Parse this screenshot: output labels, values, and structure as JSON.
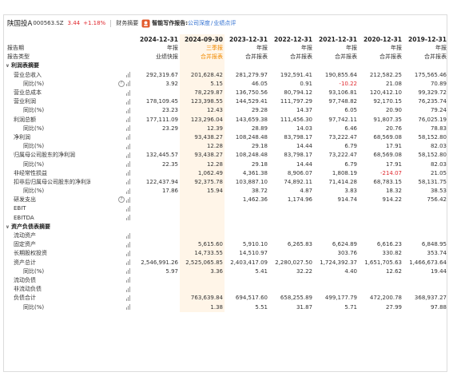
{
  "header": {
    "stock_name": "陕国投A",
    "stock_code": "000563.SZ",
    "price": "3.44",
    "change_pct": "+1.18%",
    "nav_label": "财务摘要",
    "ai_label": "智能写作报告:",
    "ai_link_1": "公司深度",
    "ai_slash": "/",
    "ai_link_2": "业绩点评"
  },
  "columns": {
    "dates": [
      "2024-12-31",
      "2024-09-30",
      "2023-12-31",
      "2022-12-31",
      "2021-12-31",
      "2020-12-31",
      "2019-12-31"
    ],
    "period_label": "报告期",
    "periods": [
      "年报",
      "三季报",
      "年报",
      "年报",
      "年报",
      "年报",
      "年报"
    ],
    "type_label": "报告类型",
    "types": [
      "业绩快报",
      "合并报表",
      "合并报表",
      "合并报表",
      "合并报表",
      "合并报表",
      "合并报表"
    ],
    "highlight_index": 1
  },
  "rows": [
    {
      "label": "利润表摘要",
      "kind": "section",
      "values": [
        "",
        "",
        "",
        "",
        "",
        "",
        ""
      ]
    },
    {
      "label": "营业总收入",
      "kind": "item",
      "icon": "bar",
      "values": [
        "292,319.67",
        "201,628.42",
        "281,279.97",
        "192,591.41",
        "190,855.64",
        "212,582.25",
        "175,565.46"
      ]
    },
    {
      "label": "同比(%)",
      "kind": "sub",
      "icon": "help-bar",
      "values": [
        "3.92",
        "5.15",
        "46.05",
        "0.91",
        "-10.22",
        "21.08",
        "70.89"
      ]
    },
    {
      "label": "营业总成本",
      "kind": "item",
      "icon": "bar",
      "values": [
        "",
        "78,229.87",
        "136,750.56",
        "80,794.12",
        "93,106.81",
        "120,412.10",
        "99,329.72"
      ]
    },
    {
      "label": "营业利润",
      "kind": "item",
      "icon": "bar",
      "values": [
        "178,109.45",
        "123,398.55",
        "144,529.41",
        "111,797.29",
        "97,748.82",
        "92,170.15",
        "76,235.74"
      ]
    },
    {
      "label": "同比(%)",
      "kind": "sub",
      "icon": "bar",
      "values": [
        "23.23",
        "12.43",
        "29.28",
        "14.37",
        "6.05",
        "20.90",
        "79.24"
      ]
    },
    {
      "label": "利润总额",
      "kind": "item",
      "icon": "bar",
      "values": [
        "177,111.09",
        "123,296.04",
        "143,659.38",
        "111,456.30",
        "97,742.11",
        "91,807.35",
        "76,025.19"
      ]
    },
    {
      "label": "同比(%)",
      "kind": "sub",
      "icon": "bar",
      "values": [
        "23.29",
        "12.39",
        "28.89",
        "14.03",
        "6.46",
        "20.76",
        "78.83"
      ]
    },
    {
      "label": "净利润",
      "kind": "item",
      "icon": "bar",
      "values": [
        "",
        "93,438.27",
        "108,248.48",
        "83,798.17",
        "73,222.47",
        "68,569.08",
        "58,152.80"
      ]
    },
    {
      "label": "同比(%)",
      "kind": "sub",
      "icon": "bar",
      "values": [
        "",
        "12.28",
        "29.18",
        "14.44",
        "6.79",
        "17.91",
        "82.03"
      ]
    },
    {
      "label": "归属母公司股东的净利润",
      "kind": "item",
      "icon": "bar",
      "values": [
        "132,445.57",
        "93,438.27",
        "108,248.48",
        "83,798.17",
        "73,222.47",
        "68,569.08",
        "58,152.80"
      ]
    },
    {
      "label": "同比(%)",
      "kind": "sub",
      "icon": "bar",
      "values": [
        "22.35",
        "12.28",
        "29.18",
        "14.44",
        "6.79",
        "17.91",
        "82.03"
      ]
    },
    {
      "label": "非经常性损益",
      "kind": "item",
      "icon": "bar",
      "values": [
        "",
        "1,062.49",
        "4,361.38",
        "8,906.07",
        "1,808.19",
        "-214.07",
        "21.05"
      ]
    },
    {
      "label": "扣非后归属母公司股东的净利润",
      "kind": "item",
      "icon": "bar",
      "values": [
        "122,437.94",
        "92,375.78",
        "103,887.10",
        "74,892.11",
        "71,414.28",
        "68,783.15",
        "58,131.75"
      ]
    },
    {
      "label": "同比(%)",
      "kind": "sub",
      "icon": "bar",
      "values": [
        "17.86",
        "15.94",
        "38.72",
        "4.87",
        "3.83",
        "18.32",
        "38.53"
      ]
    },
    {
      "label": "研发支出",
      "kind": "item",
      "icon": "help-bar",
      "values": [
        "",
        "",
        "1,462.36",
        "1,174.96",
        "914.74",
        "914.22",
        "756.42"
      ]
    },
    {
      "label": "EBIT",
      "kind": "item",
      "icon": "bar",
      "values": [
        "",
        "",
        "",
        "",
        "",
        "",
        ""
      ]
    },
    {
      "label": "EBITDA",
      "kind": "item",
      "icon": "bar",
      "values": [
        "",
        "",
        "",
        "",
        "",
        "",
        ""
      ]
    },
    {
      "label": "资产负债表摘要",
      "kind": "section",
      "values": [
        "",
        "",
        "",
        "",
        "",
        "",
        ""
      ]
    },
    {
      "label": "流动资产",
      "kind": "item",
      "icon": "bar",
      "values": [
        "",
        "",
        "",
        "",
        "",
        "",
        ""
      ]
    },
    {
      "label": "固定资产",
      "kind": "item",
      "icon": "bar",
      "values": [
        "",
        "5,615.60",
        "5,910.10",
        "6,265.83",
        "6,624.89",
        "6,616.23",
        "6,848.95"
      ]
    },
    {
      "label": "长期股权投资",
      "kind": "item",
      "icon": "bar",
      "values": [
        "",
        "14,733.55",
        "14,510.97",
        "",
        "303.76",
        "330.82",
        "353.74"
      ]
    },
    {
      "label": "资产总计",
      "kind": "item",
      "icon": "bar",
      "values": [
        "2,546,991.26",
        "2,525,065.85",
        "2,403,417.09",
        "2,280,027.50",
        "1,724,392.37",
        "1,651,705.63",
        "1,466,673.64"
      ]
    },
    {
      "label": "同比(%)",
      "kind": "sub",
      "icon": "bar",
      "values": [
        "5.97",
        "3.36",
        "5.41",
        "32.22",
        "4.40",
        "12.62",
        "19.44"
      ]
    },
    {
      "label": "流动负债",
      "kind": "item",
      "icon": "bar",
      "values": [
        "",
        "",
        "",
        "",
        "",
        "",
        ""
      ]
    },
    {
      "label": "非流动负债",
      "kind": "item",
      "icon": "bar",
      "values": [
        "",
        "",
        "",
        "",
        "",
        "",
        ""
      ]
    },
    {
      "label": "负债合计",
      "kind": "item",
      "icon": "bar",
      "values": [
        "",
        "763,639.84",
        "694,517.60",
        "658,255.89",
        "499,177.79",
        "472,200.78",
        "368,937.27"
      ]
    },
    {
      "label": "同比(%)",
      "kind": "sub",
      "icon": "bar",
      "values": [
        "",
        "1.38",
        "5.51",
        "31.87",
        "5.71",
        "27.99",
        "97.88"
      ]
    }
  ],
  "colors": {
    "accent_orange": "#f08a00",
    "negative_red": "#e0282e",
    "link_blue": "#2f6fd1",
    "highlight_bg": "#fff5e8"
  }
}
